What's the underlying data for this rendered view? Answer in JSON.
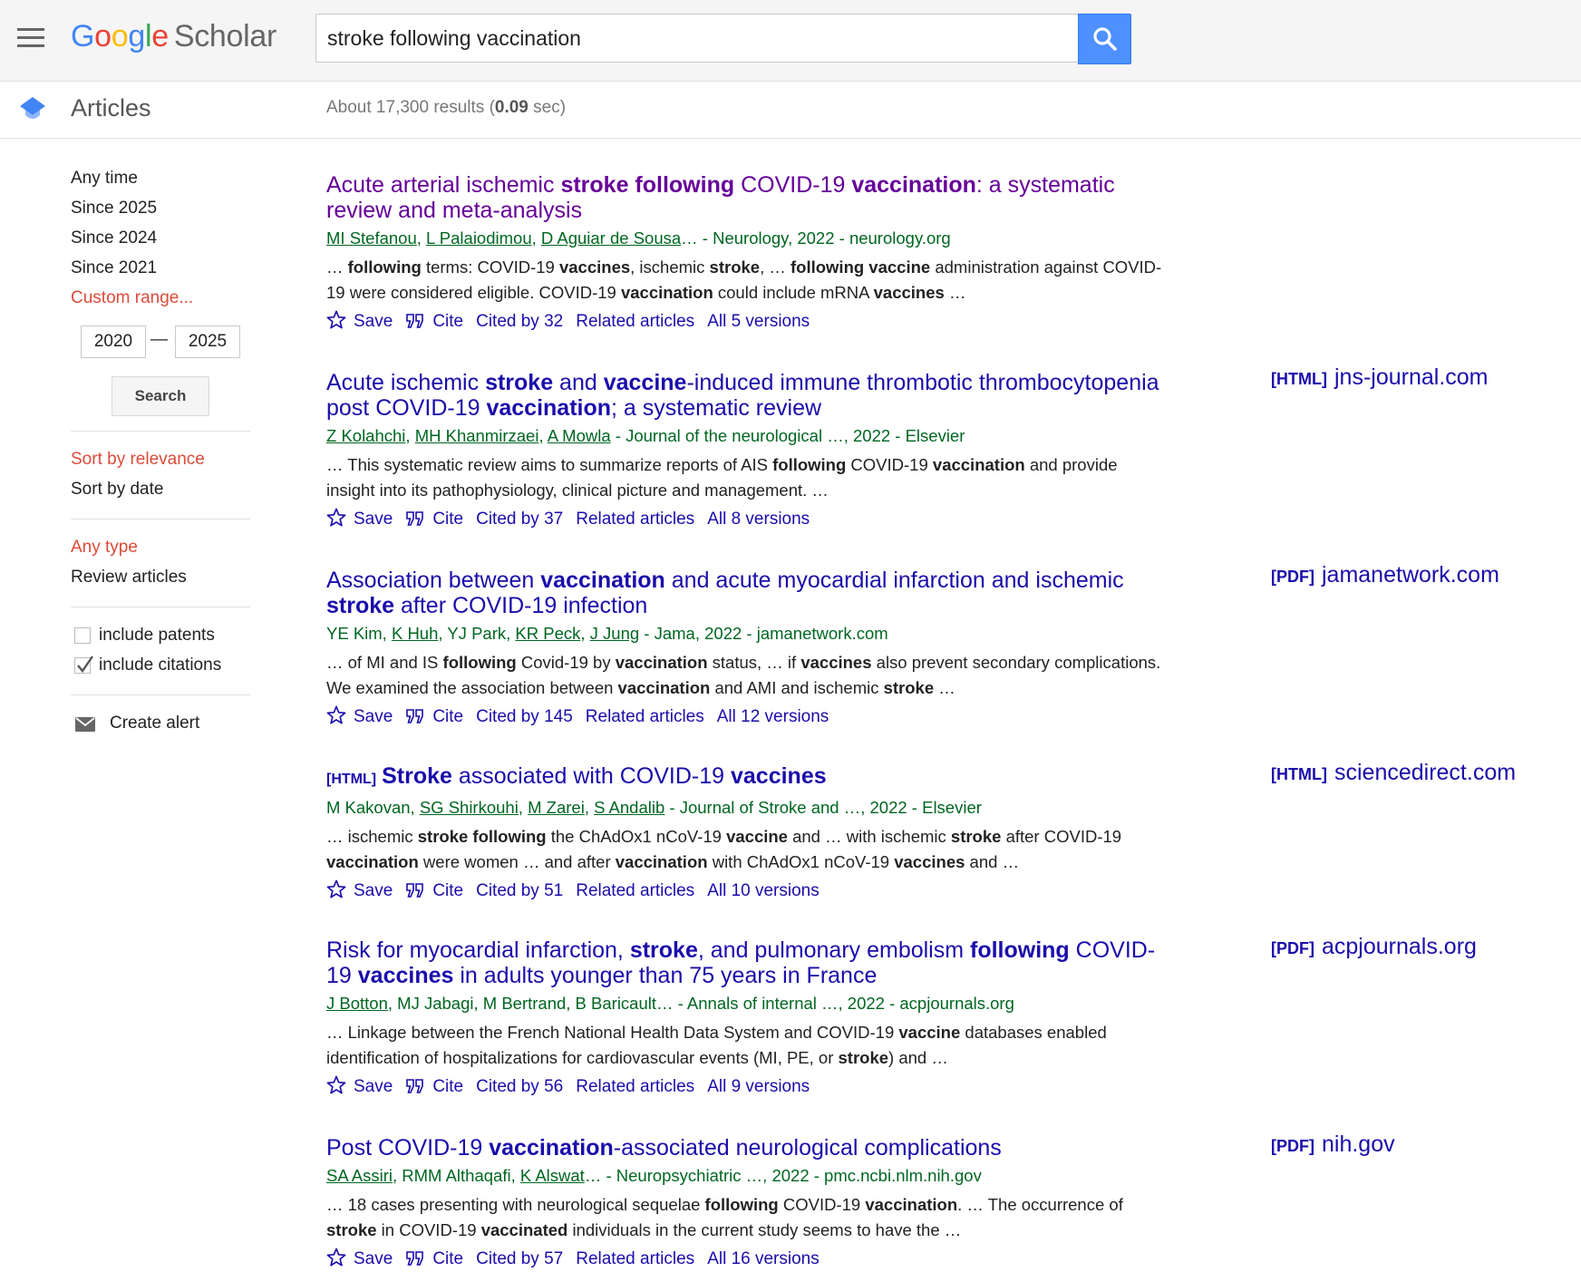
{
  "header": {
    "logo_google_letters": [
      "G",
      "o",
      "o",
      "g",
      "l",
      "e"
    ],
    "logo_colors": [
      "#4285f4",
      "#ea4335",
      "#fbbc05",
      "#4285f4",
      "#34a853",
      "#ea4335"
    ],
    "logo_scholar": "Scholar",
    "search_value": "stroke following vaccination"
  },
  "subheader": {
    "section": "Articles",
    "results_prefix": "About 17,300 results (",
    "results_time": "0.09",
    "results_suffix": " sec)"
  },
  "sidebar": {
    "time_filters": [
      "Any time",
      "Since 2025",
      "Since 2024",
      "Since 2021"
    ],
    "custom_range": "Custom range...",
    "range_from": "2020",
    "range_dash": "—",
    "range_to": "2025",
    "search_button": "Search",
    "sort_relevance": "Sort by relevance",
    "sort_date": "Sort by date",
    "any_type": "Any type",
    "review_articles": "Review articles",
    "include_patents": "include patents",
    "include_citations": "include citations",
    "create_alert": "Create alert"
  },
  "actions": {
    "save": "Save",
    "cite": "Cite",
    "related": "Related articles"
  },
  "results": [
    {
      "title_parts": [
        [
          "Acute arterial ischemic ",
          false
        ],
        [
          "stroke following",
          true
        ],
        [
          " COVID-19 ",
          false
        ],
        [
          "vaccination",
          true
        ],
        [
          ": a systematic review and meta-analysis",
          false
        ]
      ],
      "meta_parts": [
        [
          "MI Stefanou",
          true
        ],
        [
          ", ",
          false
        ],
        [
          "L Palaiodimou",
          true
        ],
        [
          ", ",
          false
        ],
        [
          "D Aguiar de Sousa",
          true
        ],
        [
          "… - Neurology, 2022 - neurology.org",
          false
        ]
      ],
      "snippet_parts": [
        [
          "… ",
          false
        ],
        [
          "following",
          true
        ],
        [
          " terms: COVID-19 ",
          false
        ],
        [
          "vaccines",
          true
        ],
        [
          ", ischemic ",
          false
        ],
        [
          "stroke",
          true
        ],
        [
          ", … ",
          false
        ],
        [
          "following vaccine",
          true
        ],
        [
          " administration against COVID-19 were considered eligible. COVID-19 ",
          false
        ],
        [
          "vaccination",
          true
        ],
        [
          " could include mRNA ",
          false
        ],
        [
          "vaccines",
          true
        ],
        [
          " …",
          false
        ]
      ],
      "cited_by": "Cited by 32",
      "versions": "All 5 versions"
    },
    {
      "title_parts": [
        [
          "Acute ischemic ",
          false
        ],
        [
          "stroke",
          true
        ],
        [
          " and ",
          false
        ],
        [
          "vaccine",
          true
        ],
        [
          "-induced immune thrombotic thrombocytopenia post COVID-19 ",
          false
        ],
        [
          "vaccination",
          true
        ],
        [
          "; a systematic review",
          false
        ]
      ],
      "meta_parts": [
        [
          "Z Kolahchi",
          true
        ],
        [
          ", ",
          false
        ],
        [
          "MH Khanmirzaei",
          true
        ],
        [
          ", ",
          false
        ],
        [
          "A Mowla",
          true
        ],
        [
          " - Journal of the neurological …, 2022 - Elsevier",
          false
        ]
      ],
      "snippet_parts": [
        [
          "… This systematic review aims to summarize reports of AIS ",
          false
        ],
        [
          "following",
          true
        ],
        [
          " COVID-19 ",
          false
        ],
        [
          "vaccination",
          true
        ],
        [
          " and provide insight into its pathophysiology, clinical picture and management. …",
          false
        ]
      ],
      "cited_by": "Cited by 37",
      "versions": "All 8 versions",
      "source_format": "[HTML]",
      "source_domain": "jns-journal.com"
    },
    {
      "title_parts": [
        [
          "Association between ",
          false
        ],
        [
          "vaccination",
          true
        ],
        [
          " and acute myocardial infarction and ischemic ",
          false
        ],
        [
          "stroke",
          true
        ],
        [
          " after COVID-19 infection",
          false
        ]
      ],
      "meta_parts": [
        [
          "YE Kim, ",
          false
        ],
        [
          "K Huh",
          true
        ],
        [
          ", YJ Park, ",
          false
        ],
        [
          "KR Peck",
          true
        ],
        [
          ", ",
          false
        ],
        [
          "J Jung",
          true
        ],
        [
          " - Jama, 2022 - jamanetwork.com",
          false
        ]
      ],
      "snippet_parts": [
        [
          "… of MI and IS ",
          false
        ],
        [
          "following",
          true
        ],
        [
          " Covid-19 by ",
          false
        ],
        [
          "vaccination",
          true
        ],
        [
          " status, … if ",
          false
        ],
        [
          "vaccines",
          true
        ],
        [
          " also prevent secondary complications. We examined the association between ",
          false
        ],
        [
          "vaccination",
          true
        ],
        [
          " and AMI and ischemic ",
          false
        ],
        [
          "stroke",
          true
        ],
        [
          " …",
          false
        ]
      ],
      "cited_by": "Cited by 145",
      "versions": "All 12 versions",
      "source_format": "[PDF]",
      "source_domain": "jamanetwork.com"
    },
    {
      "title_tag": "[HTML]",
      "title_parts": [
        [
          "Stroke",
          true
        ],
        [
          " associated with COVID-19 ",
          false
        ],
        [
          "vaccines",
          true
        ]
      ],
      "meta_parts": [
        [
          "M Kakovan, ",
          false
        ],
        [
          "SG Shirkouhi",
          true
        ],
        [
          ", ",
          false
        ],
        [
          "M Zarei",
          true
        ],
        [
          ", ",
          false
        ],
        [
          "S Andalib",
          true
        ],
        [
          " - Journal of ",
          false
        ],
        [
          "Stroke",
          false
        ],
        [
          " and …, 2022 - Elsevier",
          false
        ]
      ],
      "snippet_parts": [
        [
          "… ischemic ",
          false
        ],
        [
          "stroke following",
          true
        ],
        [
          " the ChAdOx1 nCoV-19 ",
          false
        ],
        [
          "vaccine",
          true
        ],
        [
          " and … with ischemic ",
          false
        ],
        [
          "stroke",
          true
        ],
        [
          " after COVID-19 ",
          false
        ],
        [
          "vaccination",
          true
        ],
        [
          " were women … and after ",
          false
        ],
        [
          "vaccination",
          true
        ],
        [
          " with ChAdOx1 nCoV-19 ",
          false
        ],
        [
          "vaccines",
          true
        ],
        [
          " and …",
          false
        ]
      ],
      "cited_by": "Cited by 51",
      "versions": "All 10 versions",
      "source_format": "[HTML]",
      "source_domain": "sciencedirect.com"
    },
    {
      "title_parts": [
        [
          "Risk for myocardial infarction, ",
          false
        ],
        [
          "stroke",
          true
        ],
        [
          ", and pulmonary embolism ",
          false
        ],
        [
          "following",
          true
        ],
        [
          " COVID-19 ",
          false
        ],
        [
          "vaccines",
          true
        ],
        [
          " in adults younger than 75 years in France",
          false
        ]
      ],
      "meta_parts": [
        [
          "J Botton",
          true
        ],
        [
          ", MJ Jabagi, M Bertrand, B Baricault… - Annals of internal …, 2022 - acpjournals.org",
          false
        ]
      ],
      "snippet_parts": [
        [
          "… Linkage between the French National Health Data System and COVID-19 ",
          false
        ],
        [
          "vaccine",
          true
        ],
        [
          " databases enabled identification of hospitalizations for cardiovascular events (MI, PE, or ",
          false
        ],
        [
          "stroke",
          true
        ],
        [
          ") and …",
          false
        ]
      ],
      "cited_by": "Cited by 56",
      "versions": "All 9 versions",
      "source_format": "[PDF]",
      "source_domain": "acpjournals.org"
    },
    {
      "title_parts": [
        [
          "Post COVID-19 ",
          false
        ],
        [
          "vaccination",
          true
        ],
        [
          "-associated neurological complications",
          false
        ]
      ],
      "meta_parts": [
        [
          "SA Assiri",
          true
        ],
        [
          ", RMM Althaqafi, ",
          false
        ],
        [
          "K Alswat",
          true
        ],
        [
          "… - Neuropsychiatric …, 2022 - pmc.ncbi.nlm.nih.gov",
          false
        ]
      ],
      "snippet_parts": [
        [
          "… 18 cases presenting with neurological sequelae ",
          false
        ],
        [
          "following",
          true
        ],
        [
          " COVID-19 ",
          false
        ],
        [
          "vaccination",
          true
        ],
        [
          ". … The occurrence of ",
          false
        ],
        [
          "stroke",
          true
        ],
        [
          " in COVID-19 ",
          false
        ],
        [
          "vaccinated",
          true
        ],
        [
          " individuals in the current study seems to have the …",
          false
        ]
      ],
      "cited_by": "Cited by 57",
      "versions": "All 16 versions",
      "source_format": "[PDF]",
      "source_domain": "nih.gov"
    }
  ]
}
